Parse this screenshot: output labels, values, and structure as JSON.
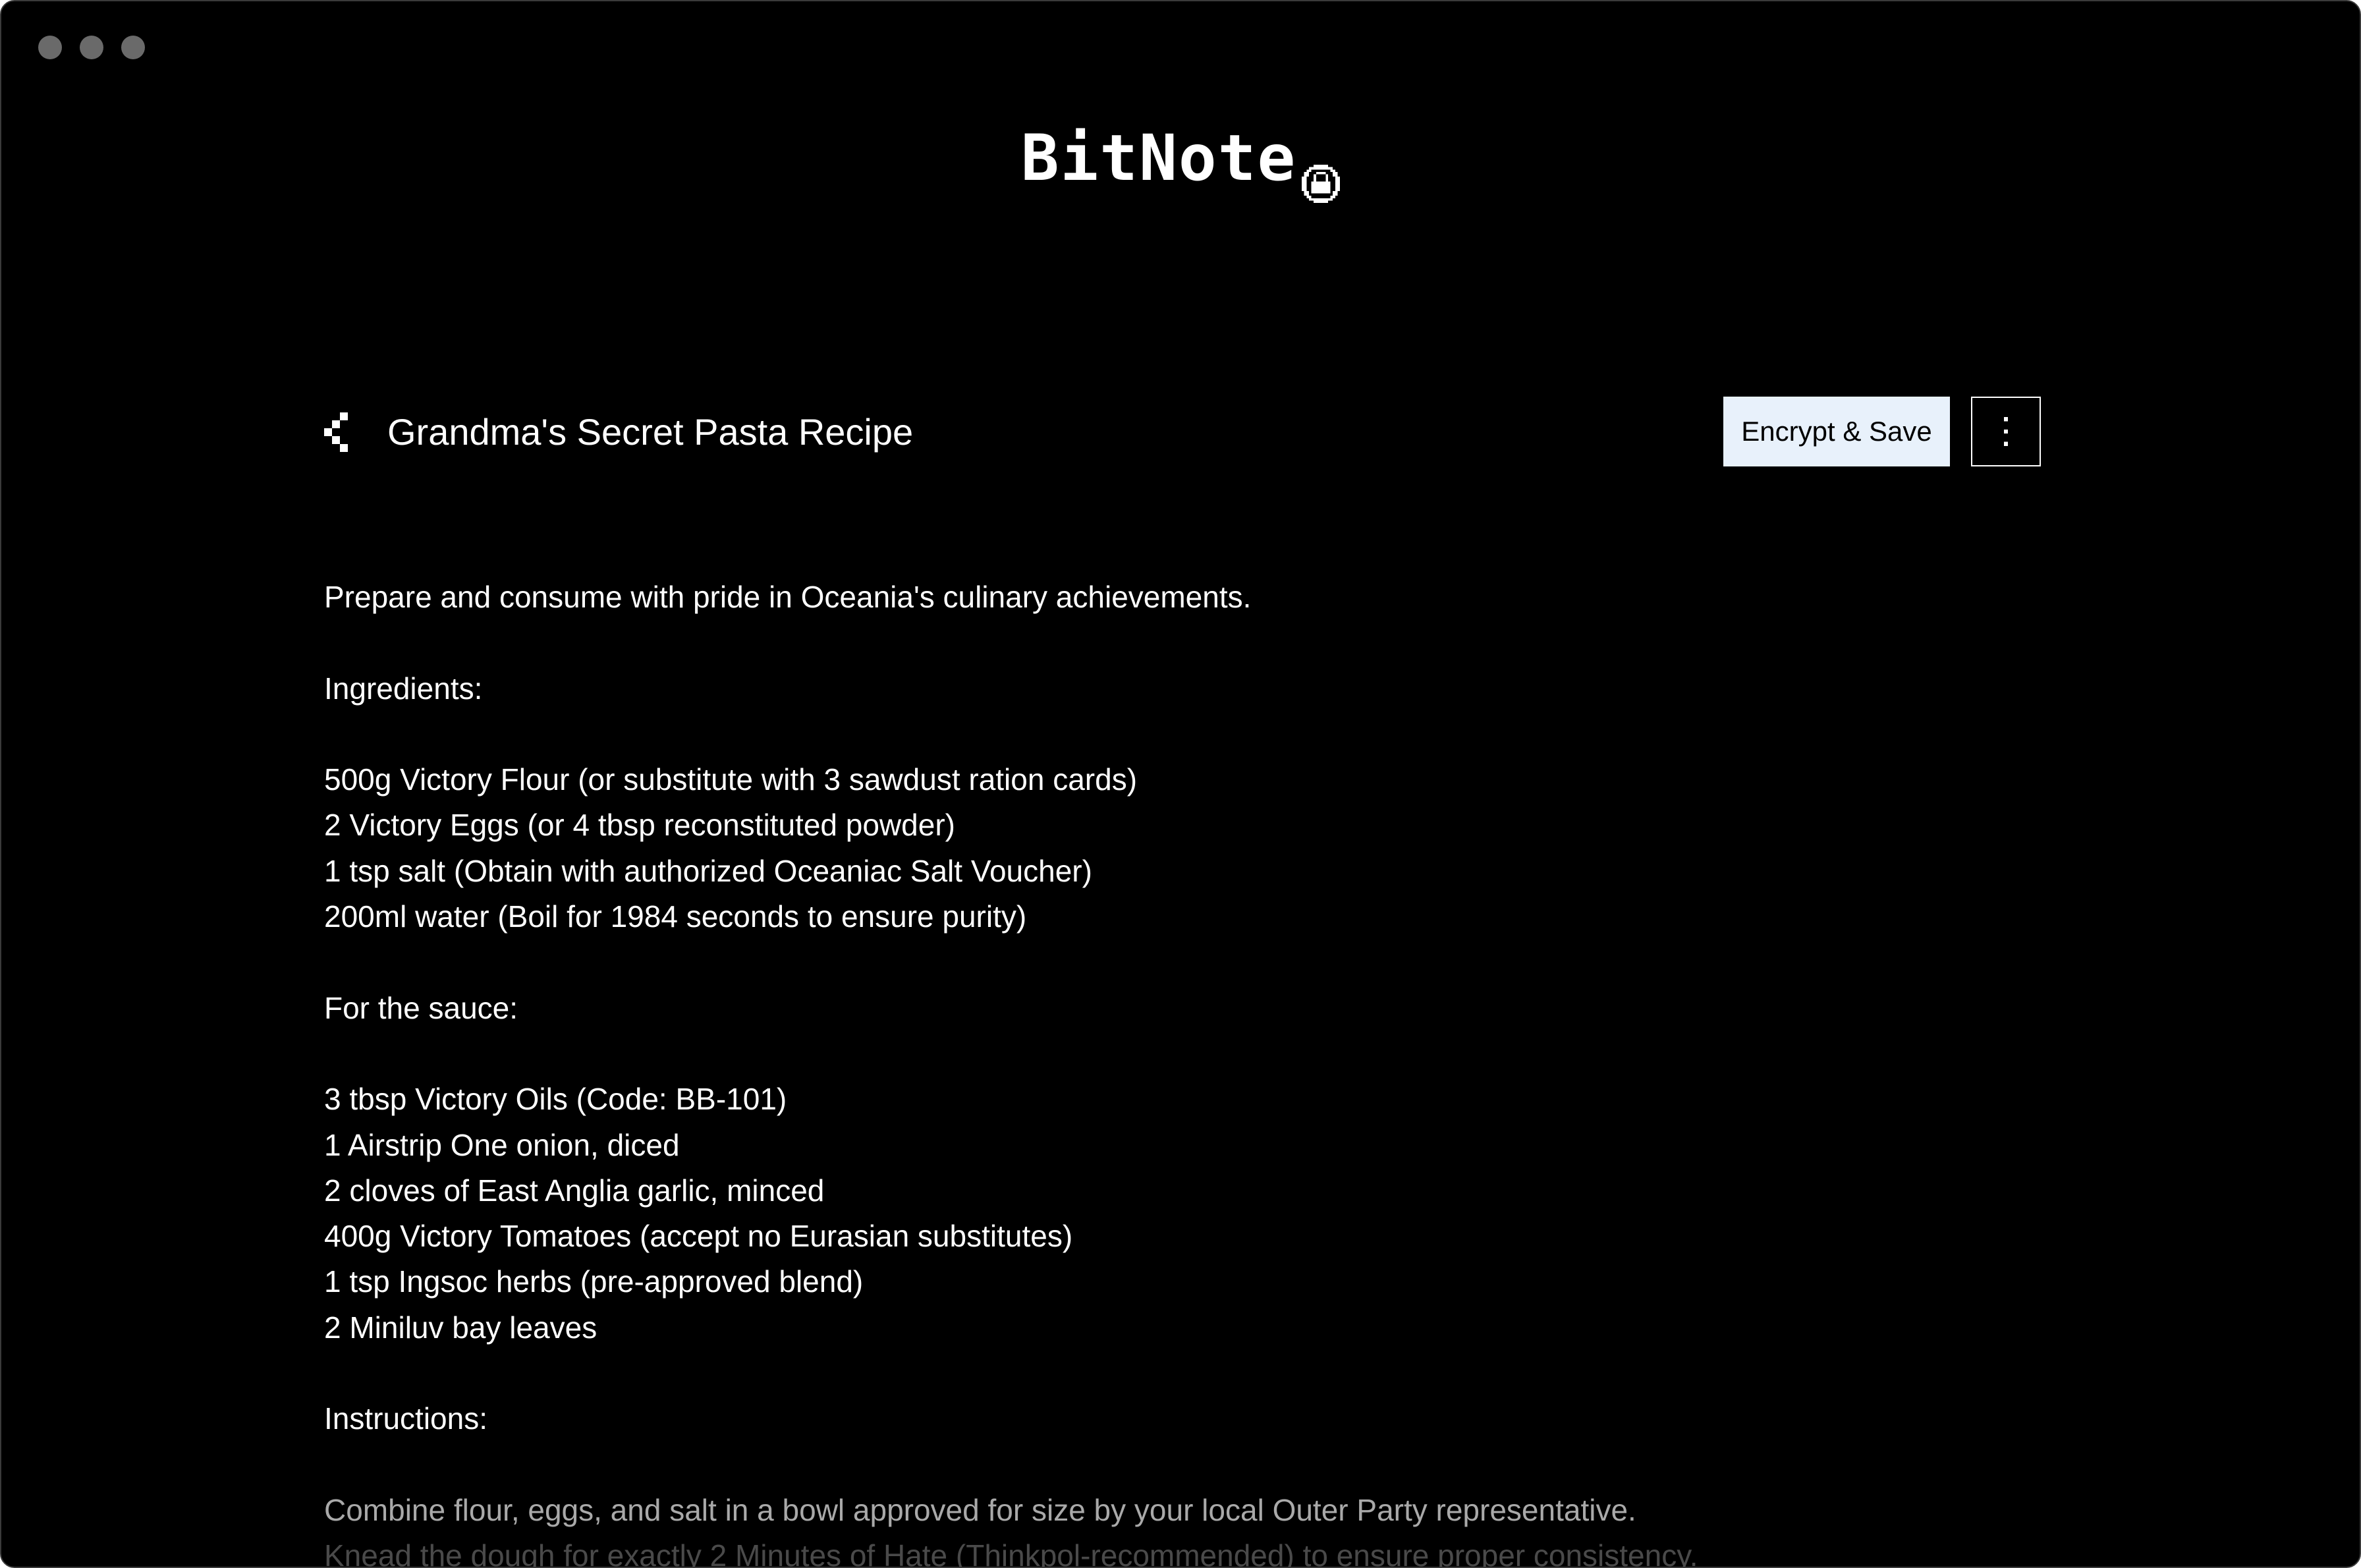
{
  "app": {
    "title": "BitNote"
  },
  "note": {
    "title": "Grandma's Secret Pasta Recipe",
    "lines": [
      "Prepare and consume with pride in Oceania's culinary achievements.",
      "",
      "Ingredients:",
      "",
      "500g Victory Flour (or substitute with 3 sawdust ration cards)",
      "2 Victory Eggs (or 4 tbsp reconstituted powder)",
      "1 tsp salt (Obtain with authorized Oceaniac Salt Voucher)",
      "200ml water (Boil for 1984 seconds to ensure purity)",
      "",
      "For the sauce:",
      "",
      "3 tbsp Victory Oils (Code: BB-101)",
      "1 Airstrip One onion, diced",
      "2 cloves of East Anglia garlic, minced",
      "400g Victory Tomatoes (accept no Eurasian substitutes)",
      "1 tsp Ingsoc herbs (pre-approved blend)",
      "2 Miniluv bay leaves",
      "",
      "Instructions:",
      "",
      "Combine flour, eggs, and salt in a bowl approved for size by your local Outer Party representative.",
      "Knead the dough for exactly 2 Minutes of Hate (Thinkpol-recommended) to ensure proper consistency."
    ]
  },
  "toolbar": {
    "encrypt_label": "Encrypt & Save"
  },
  "icons": {
    "back": "chevron-left-icon",
    "more": "vertical-ellipsis-icon",
    "lock": "lock-icon"
  },
  "colors": {
    "background": "#000000",
    "text": "#ffffff",
    "button_background": "#e8f1fb",
    "traffic_light": "#6a6a6a"
  }
}
